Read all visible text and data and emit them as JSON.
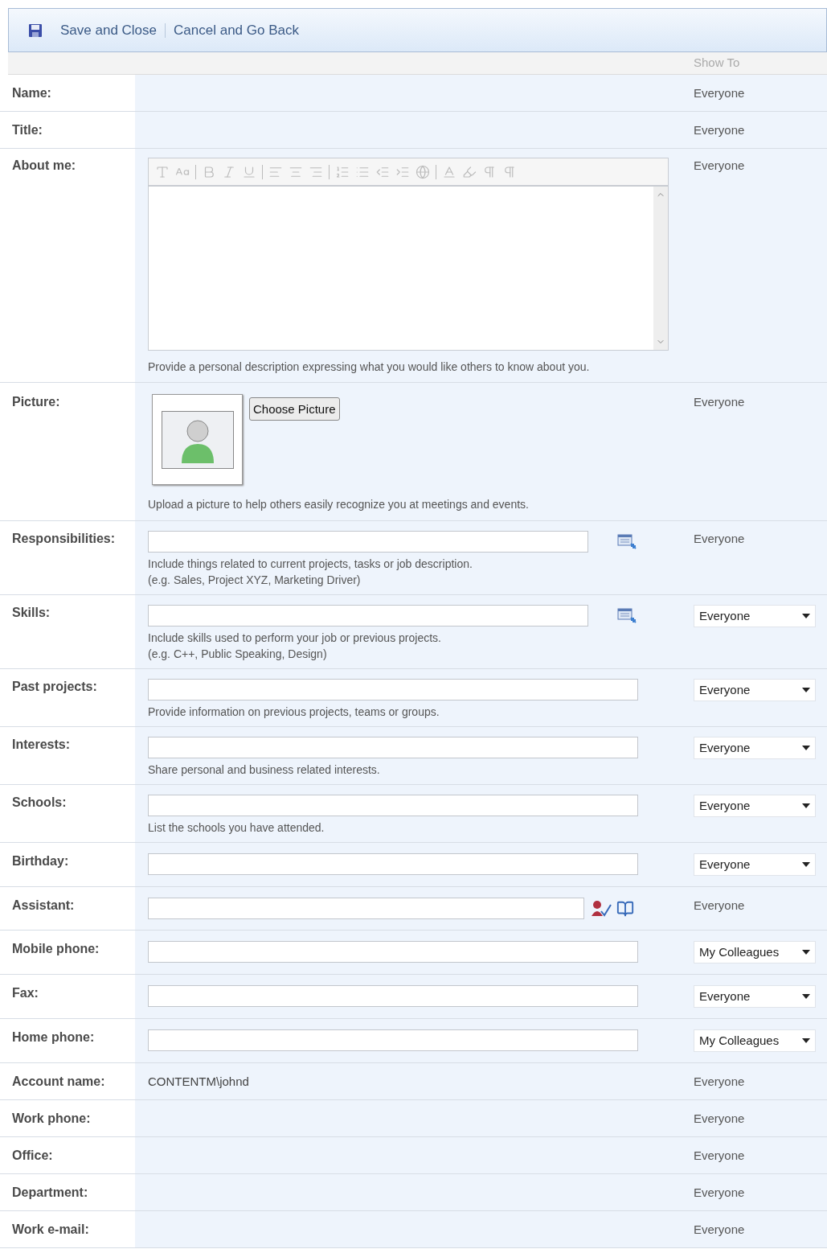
{
  "toolbar": {
    "actions": [
      "Save and Close",
      "Cancel and Go Back"
    ]
  },
  "header": {
    "show_to": "Show To"
  },
  "fields": [
    {
      "label": "Name:",
      "kind": "static",
      "visibility": {
        "kind": "text",
        "value": "Everyone"
      }
    },
    {
      "label": "Title:",
      "kind": "static",
      "visibility": {
        "kind": "text",
        "value": "Everyone"
      }
    },
    {
      "label": "About me:",
      "kind": "rich",
      "hint": "Provide a personal description expressing what you would like others to know about you.",
      "visibility": {
        "kind": "text",
        "value": "Everyone"
      }
    },
    {
      "label": "Picture:",
      "kind": "picture",
      "button": "Choose Picture",
      "hint": "Upload a picture to help others easily recognize you at meetings and events.",
      "visibility": {
        "kind": "text",
        "value": "Everyone"
      }
    },
    {
      "label": "Responsibilities:",
      "kind": "lookup_input",
      "hint": "Include things related to current projects, tasks or job description.",
      "example": "(e.g. Sales, Project XYZ, Marketing Driver)",
      "visibility": {
        "kind": "text",
        "value": "Everyone"
      }
    },
    {
      "label": "Skills:",
      "kind": "lookup_input",
      "hint": "Include skills used to perform your job or previous projects.",
      "example": "(e.g. C++, Public Speaking, Design)",
      "visibility": {
        "kind": "dropdown",
        "value": "Everyone"
      }
    },
    {
      "label": "Past projects:",
      "kind": "input",
      "hint": "Provide information on previous projects, teams or groups.",
      "visibility": {
        "kind": "dropdown",
        "value": "Everyone"
      }
    },
    {
      "label": "Interests:",
      "kind": "input",
      "hint": "Share personal and business related interests.",
      "visibility": {
        "kind": "dropdown",
        "value": "Everyone"
      }
    },
    {
      "label": "Schools:",
      "kind": "input",
      "hint": "List the schools you have attended.",
      "visibility": {
        "kind": "dropdown",
        "value": "Everyone"
      }
    },
    {
      "label": "Birthday:",
      "kind": "input",
      "visibility": {
        "kind": "dropdown",
        "value": "Everyone"
      }
    },
    {
      "label": "Assistant:",
      "kind": "people_input",
      "visibility": {
        "kind": "text",
        "value": "Everyone"
      }
    },
    {
      "label": "Mobile phone:",
      "kind": "input",
      "visibility": {
        "kind": "dropdown",
        "value": "My Colleagues"
      }
    },
    {
      "label": "Fax:",
      "kind": "input",
      "visibility": {
        "kind": "dropdown",
        "value": "Everyone"
      }
    },
    {
      "label": "Home phone:",
      "kind": "input",
      "visibility": {
        "kind": "dropdown",
        "value": "My Colleagues"
      }
    },
    {
      "label": "Account name:",
      "kind": "value",
      "value": "CONTENTM\\johnd",
      "visibility": {
        "kind": "text",
        "value": "Everyone"
      }
    },
    {
      "label": "Work phone:",
      "kind": "static",
      "visibility": {
        "kind": "text",
        "value": "Everyone"
      }
    },
    {
      "label": "Office:",
      "kind": "static",
      "visibility": {
        "kind": "text",
        "value": "Everyone"
      }
    },
    {
      "label": "Department:",
      "kind": "static",
      "visibility": {
        "kind": "text",
        "value": "Everyone"
      }
    },
    {
      "label": "Work e-mail:",
      "kind": "static",
      "visibility": {
        "kind": "text",
        "value": "Everyone"
      }
    }
  ]
}
